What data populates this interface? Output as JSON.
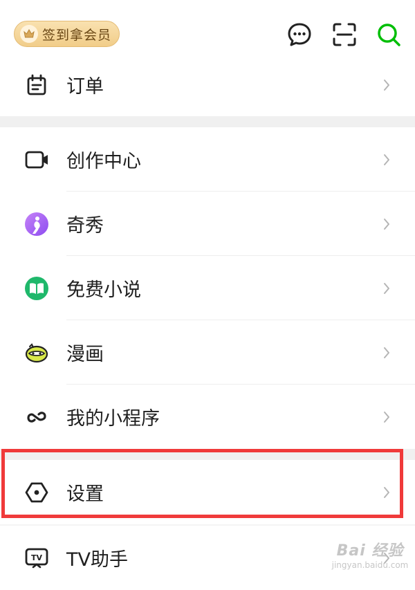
{
  "header": {
    "checkin_label": "签到拿会员",
    "icons": [
      "crown-icon",
      "message-icon",
      "scan-icon",
      "search-icon"
    ]
  },
  "menu": {
    "orders": "订单",
    "creator_center": "创作中心",
    "qixiu": "奇秀",
    "free_novels": "免费小说",
    "comics": "漫画",
    "mini_programs": "我的小程序",
    "settings": "设置",
    "tv_assistant": "TV助手"
  },
  "colors": {
    "accent_green": "#00be06",
    "highlight_red": "#f03a3a",
    "gold_button": "#f1cd89"
  },
  "watermark": {
    "brand": "Bai 经验",
    "url": "jingyan.baidu.com"
  }
}
